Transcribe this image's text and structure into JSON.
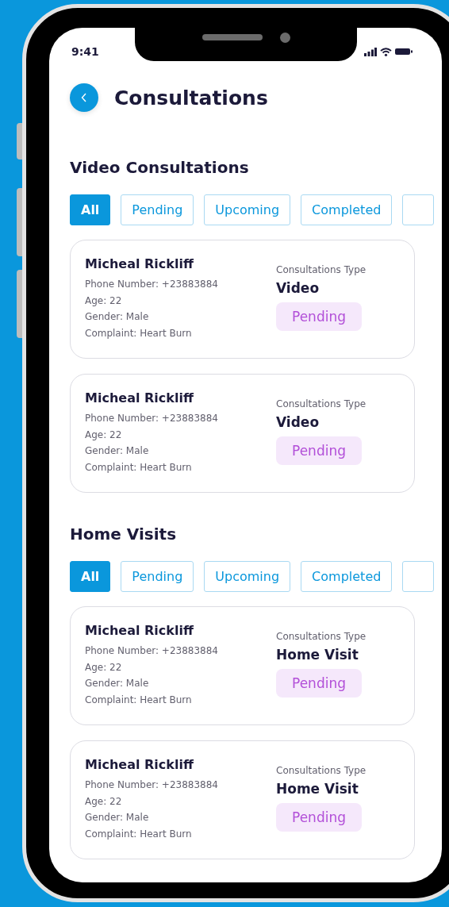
{
  "status_bar": {
    "time": "9:41"
  },
  "header": {
    "title": "Consultations"
  },
  "sections": [
    {
      "title": "Video Consultations",
      "filters": [
        {
          "label": "All",
          "selected": true
        },
        {
          "label": "Pending",
          "selected": false
        },
        {
          "label": "Upcoming",
          "selected": false
        },
        {
          "label": "Completed",
          "selected": false
        }
      ],
      "consultations": [
        {
          "name": "Micheal Rickliff",
          "phone": "Phone Number: +23883884",
          "age": "Age: 22",
          "gender": "Gender: Male",
          "complaint": "Complaint: Heart Burn",
          "type_label": "Consultations Type",
          "type": "Video",
          "status": "Pending"
        },
        {
          "name": "Micheal Rickliff",
          "phone": "Phone Number: +23883884",
          "age": "Age: 22",
          "gender": "Gender: Male",
          "complaint": "Complaint: Heart Burn",
          "type_label": "Consultations Type",
          "type": "Video",
          "status": "Pending"
        }
      ]
    },
    {
      "title": "Home Visits",
      "filters": [
        {
          "label": "All",
          "selected": true
        },
        {
          "label": "Pending",
          "selected": false
        },
        {
          "label": "Upcoming",
          "selected": false
        },
        {
          "label": "Completed",
          "selected": false
        }
      ],
      "consultations": [
        {
          "name": "Micheal Rickliff",
          "phone": "Phone Number: +23883884",
          "age": "Age: 22",
          "gender": "Gender: Male",
          "complaint": "Complaint: Heart Burn",
          "type_label": "Consultations Type",
          "type": "Home Visit",
          "status": "Pending"
        },
        {
          "name": "Micheal Rickliff",
          "phone": "Phone Number: +23883884",
          "age": "Age: 22",
          "gender": "Gender: Male",
          "complaint": "Complaint: Heart Burn",
          "type_label": "Consultations Type",
          "type": "Home Visit",
          "status": "Pending"
        }
      ]
    }
  ]
}
